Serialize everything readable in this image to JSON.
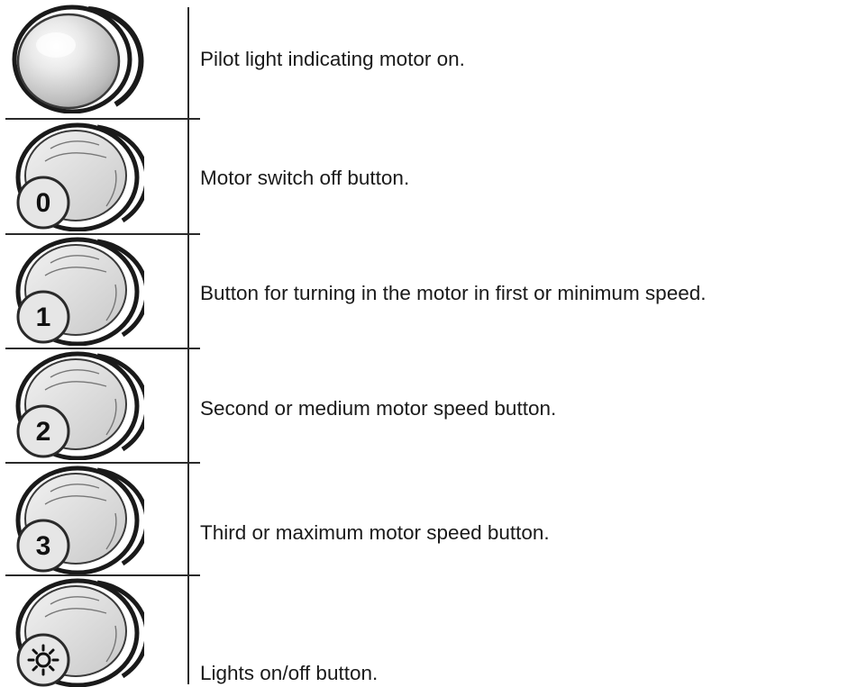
{
  "controls": [
    {
      "symbol": "",
      "icon": "pilot-light-icon",
      "description": "Pilot light indicating motor on."
    },
    {
      "symbol": "0",
      "icon": "motor-off-button-icon",
      "description": "Motor switch off button."
    },
    {
      "symbol": "1",
      "icon": "speed-1-button-icon",
      "description": "Button for turning in the motor in first or minimum  speed."
    },
    {
      "symbol": "2",
      "icon": "speed-2-button-icon",
      "description": "Second or medium motor speed button."
    },
    {
      "symbol": "3",
      "icon": "speed-3-button-icon",
      "description": "Third or maximum motor speed button."
    },
    {
      "symbol": "",
      "icon": "lights-button-icon",
      "description": "Lights on/off button."
    }
  ]
}
